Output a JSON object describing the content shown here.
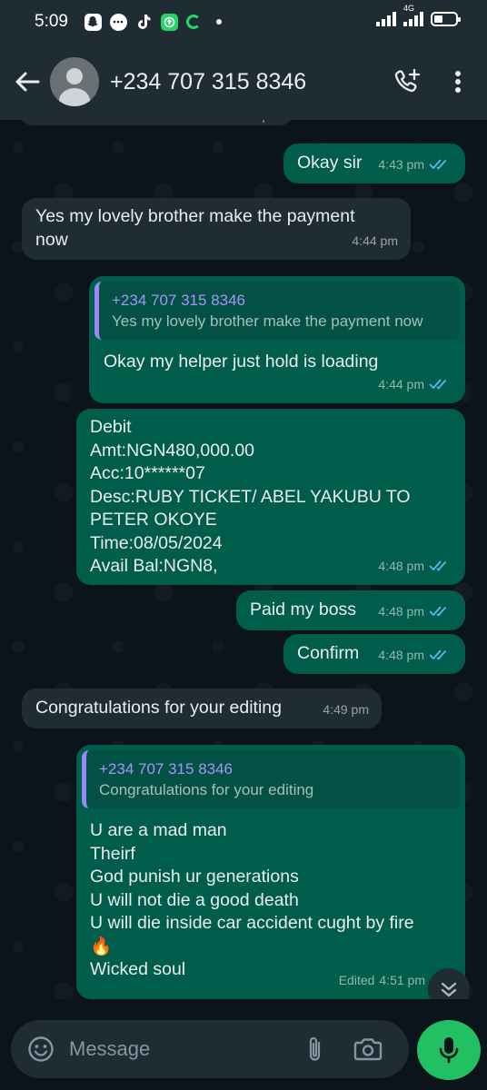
{
  "status_bar": {
    "time": "5:09",
    "network": "4G",
    "notification_icons": [
      "snapchat-icon",
      "chat-icon",
      "tiktok-icon",
      "app-icon",
      "sync-icon",
      "dot-icon"
    ]
  },
  "header": {
    "contact_name": "+234 707 315 8346",
    "icons": [
      "back-arrow-icon",
      "avatar-icon",
      "add-call-icon",
      "more-vert-icon"
    ]
  },
  "partial_top_time": "4:43 pm",
  "messages": [
    {
      "dir": "out",
      "text": "Okay sir",
      "time": "4:43 pm",
      "read": true
    },
    {
      "dir": "in",
      "text": "Yes my lovely brother make the payment now",
      "time": "4:44 pm"
    },
    {
      "dir": "out",
      "quote": {
        "name": "+234 707 315 8346",
        "text": "Yes my lovely brother make the payment now"
      },
      "text": "Okay my helper just hold is loading",
      "time": "4:44 pm",
      "read": true
    },
    {
      "dir": "out",
      "text": "Debit\nAmt:NGN480,000.00\nAcc:10******07\nDesc:RUBY TICKET/ ABEL YAKUBU TO PETER OKOYE\nTime:08/05/2024\nAvail Bal:NGN8,",
      "time": "4:48 pm",
      "read": true
    },
    {
      "dir": "out",
      "text": "Paid my boss",
      "time": "4:48 pm",
      "read": true
    },
    {
      "dir": "out",
      "text": "Confirm",
      "time": "4:48 pm",
      "read": true
    },
    {
      "dir": "in",
      "text": "Congratulations for your editing",
      "time": "4:49 pm"
    },
    {
      "dir": "out",
      "quote": {
        "name": "+234 707 315 8346",
        "text": "Congratulations for your editing"
      },
      "text": "U are a mad man\nTheirf\nGod punish ur generations\nU will not die a good death\nU will die inside car accident cught by fire\n🔥\nWicked soul",
      "edited_label": "Edited",
      "time": "4:51 pm",
      "read": true
    }
  ],
  "composer": {
    "placeholder": "Message",
    "icons": [
      "emoji-icon",
      "attach-icon",
      "camera-icon",
      "mic-icon"
    ]
  },
  "colors": {
    "background": "#0b141a",
    "bar": "#1f2c34",
    "outgoing_bubble": "#005c4b",
    "incoming_bubble": "#202c33",
    "read_ticks": "#53bdeb",
    "quote_name": "#a694f7",
    "mic_button": "#21c063"
  }
}
